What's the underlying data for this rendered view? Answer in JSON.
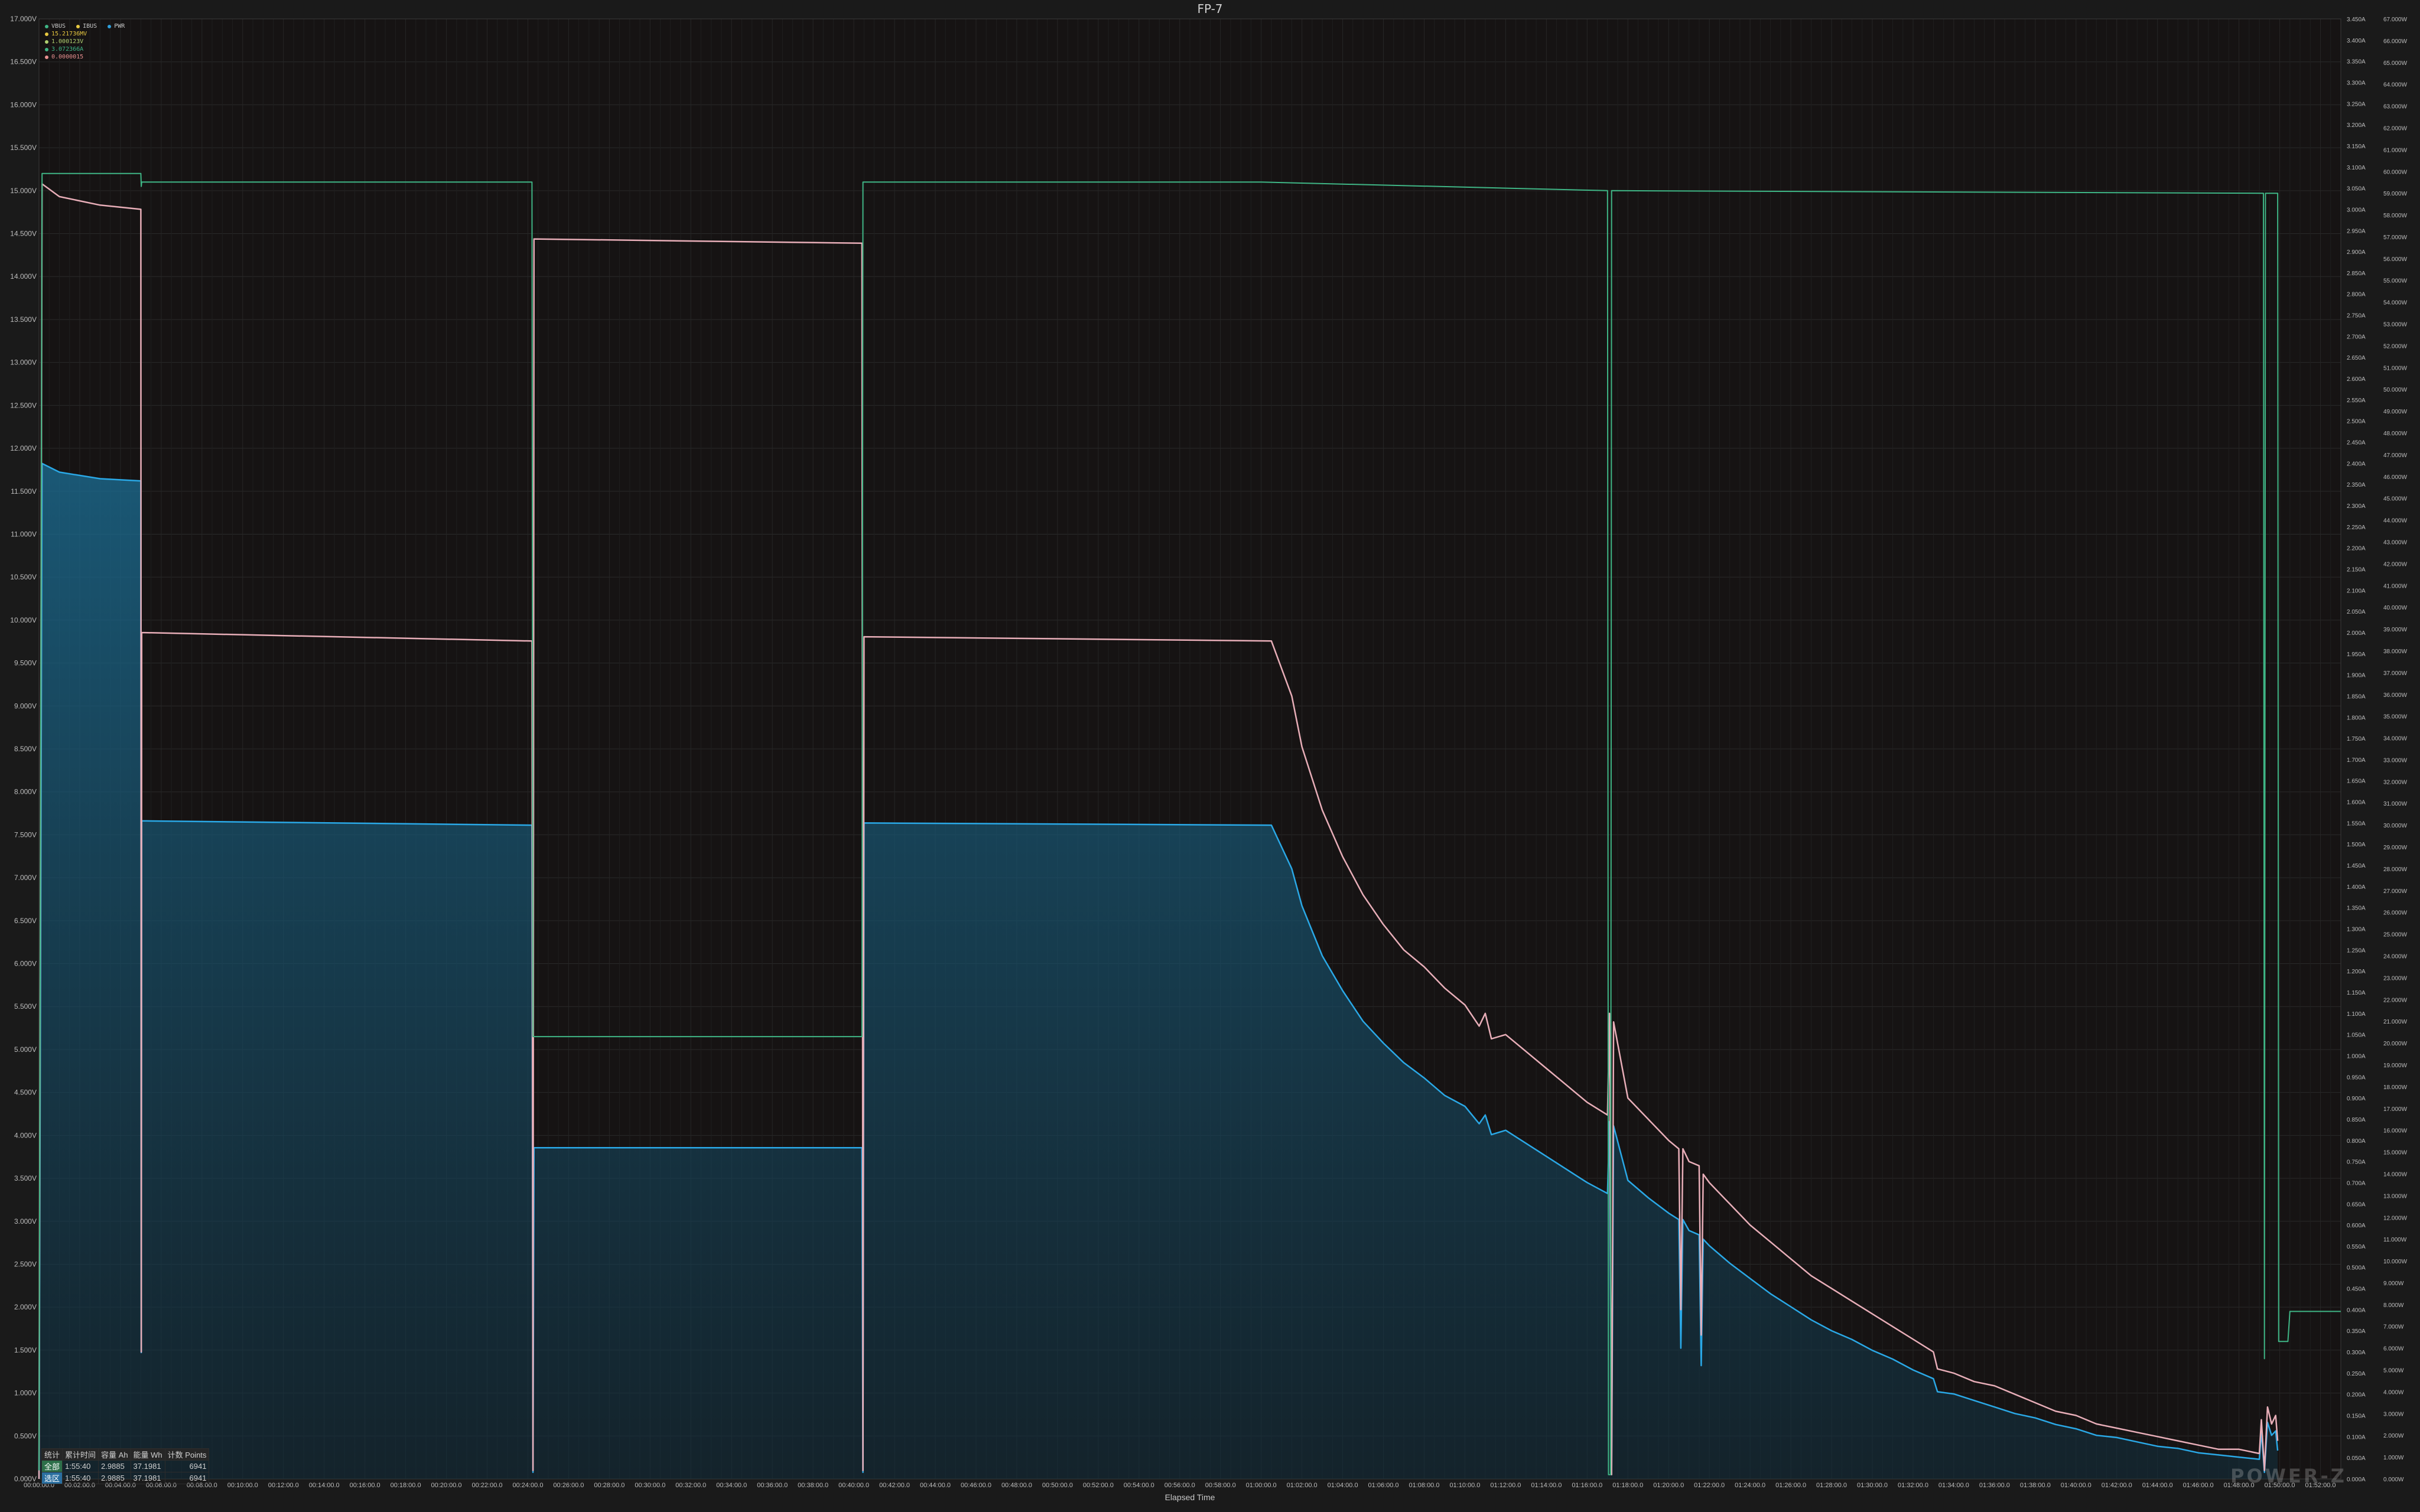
{
  "window": {
    "title": "FP-7"
  },
  "legend": [
    {
      "name": "VBUS",
      "color": "#3fb585"
    },
    {
      "name": "IBUS",
      "color": "#e8c840"
    },
    {
      "name": "PWR",
      "color": "#2f9fdc"
    }
  ],
  "readings": [
    {
      "value": "15.21736MV",
      "color": "#e8c840"
    },
    {
      "value": "1.000123V",
      "color": "#b0d070"
    },
    {
      "value": "3.072366A",
      "color": "#3fb585"
    },
    {
      "value": "0.0000015",
      "color": "#e89090"
    }
  ],
  "stats": {
    "headers": [
      "统计",
      "累计时间",
      "容量 Ah",
      "能量 Wh",
      "计数 Points"
    ],
    "rows": [
      {
        "tag": "全部",
        "time": "1:55:40",
        "ah": "2.9885",
        "wh": "37.1981",
        "points": "6941"
      },
      {
        "tag": "选区",
        "time": "1:55:40",
        "ah": "2.9885",
        "wh": "37.1981",
        "points": "6941"
      }
    ]
  },
  "watermark": "POWER-Z",
  "chart_data": {
    "type": "line",
    "title": "FP-7",
    "xlabel": "Elapsed Time",
    "xlim": [
      0,
      113
    ],
    "x_unit": "minutes",
    "x_ticks": [
      "00:00:00.0",
      "00:02:00.0",
      "00:04:00.0",
      "00:06:00.0",
      "00:08:00.0",
      "00:10:00.0",
      "00:12:00.0",
      "00:14:00.0",
      "00:16:00.0",
      "00:18:00.0",
      "00:20:00.0",
      "00:22:00.0",
      "00:24:00.0",
      "00:26:00.0",
      "00:28:00.0",
      "00:30:00.0",
      "00:32:00.0",
      "00:34:00.0",
      "00:36:00.0",
      "00:38:00.0",
      "00:40:00.0",
      "00:42:00.0",
      "00:44:00.0",
      "00:46:00.0",
      "00:48:00.0",
      "00:50:00.0",
      "00:52:00.0",
      "00:54:00.0",
      "00:56:00.0",
      "00:58:00.0",
      "01:00:00.0",
      "01:02:00.0",
      "01:04:00.0",
      "01:06:00.0",
      "01:08:00.0",
      "01:10:00.0",
      "01:12:00.0",
      "01:14:00.0",
      "01:16:00.0",
      "01:18:00.0",
      "01:20:00.0",
      "01:22:00.0",
      "01:24:00.0",
      "01:26:00.0",
      "01:28:00.0",
      "01:30:00.0",
      "01:32:00.0",
      "01:34:00.0",
      "01:36:00.0",
      "01:38:00.0",
      "01:40:00.0",
      "01:42:00.0",
      "01:44:00.0",
      "01:46:00.0",
      "01:48:00.0",
      "01:50:00.0",
      "01:52:00.0",
      "01:54:00.0"
    ],
    "y_left": {
      "min": 0,
      "max": 17,
      "step": 0.5,
      "unit": "V"
    },
    "y_right_current": {
      "min": 0,
      "max": 3.45,
      "step": 0.05,
      "unit": "A"
    },
    "y_right_power": {
      "min": 0,
      "max": 67,
      "step": 1,
      "unit": "W"
    },
    "grid": true,
    "legend_position": "top-left",
    "series": [
      {
        "name": "VBUS",
        "color": "#3fb585",
        "axis": "voltage",
        "points": [
          [
            0,
            0.1
          ],
          [
            0.15,
            15.2
          ],
          [
            5,
            15.2
          ],
          [
            5.02,
            15.05
          ],
          [
            5.04,
            15.1
          ],
          [
            24.2,
            15.1
          ],
          [
            24.25,
            5.15
          ],
          [
            40.4,
            5.15
          ],
          [
            40.45,
            15.1
          ],
          [
            60,
            15.1
          ],
          [
            77,
            15.0
          ],
          [
            77.05,
            0.05
          ],
          [
            77.15,
            0.05
          ],
          [
            77.2,
            15.0
          ],
          [
            109.2,
            14.97
          ],
          [
            109.25,
            1.4
          ],
          [
            109.3,
            14.97
          ],
          [
            109.9,
            14.97
          ],
          [
            109.95,
            1.6
          ],
          [
            110.4,
            1.6
          ],
          [
            110.5,
            1.95
          ],
          [
            113,
            1.95
          ]
        ]
      },
      {
        "name": "IBUS",
        "color": "#e8aeb8",
        "axis": "current",
        "points": [
          [
            0,
            0.0
          ],
          [
            0.15,
            3.06
          ],
          [
            1,
            3.03
          ],
          [
            3,
            3.01
          ],
          [
            5,
            3.0
          ],
          [
            5.02,
            0.3
          ],
          [
            5.04,
            2.0
          ],
          [
            24.2,
            1.98
          ],
          [
            24.25,
            0.02
          ],
          [
            24.3,
            2.93
          ],
          [
            40.4,
            2.92
          ],
          [
            40.45,
            0.02
          ],
          [
            40.5,
            1.99
          ],
          [
            60.5,
            1.98
          ],
          [
            61.5,
            1.85
          ],
          [
            62,
            1.73
          ],
          [
            63,
            1.58
          ],
          [
            64,
            1.47
          ],
          [
            65,
            1.38
          ],
          [
            66,
            1.31
          ],
          [
            67,
            1.25
          ],
          [
            68,
            1.21
          ],
          [
            69,
            1.16
          ],
          [
            70,
            1.12
          ],
          [
            70.7,
            1.07
          ],
          [
            71,
            1.1
          ],
          [
            71.3,
            1.04
          ],
          [
            72,
            1.05
          ],
          [
            73,
            1.01
          ],
          [
            74,
            0.97
          ],
          [
            75,
            0.93
          ],
          [
            76,
            0.89
          ],
          [
            77,
            0.86
          ],
          [
            77.1,
            1.1
          ],
          [
            77.2,
            0.01
          ],
          [
            77.3,
            1.08
          ],
          [
            78,
            0.9
          ],
          [
            79,
            0.85
          ],
          [
            80,
            0.8
          ],
          [
            80.5,
            0.78
          ],
          [
            80.6,
            0.4
          ],
          [
            80.7,
            0.78
          ],
          [
            81,
            0.75
          ],
          [
            81.5,
            0.74
          ],
          [
            81.6,
            0.34
          ],
          [
            81.7,
            0.72
          ],
          [
            82,
            0.7
          ],
          [
            83,
            0.65
          ],
          [
            84,
            0.6
          ],
          [
            85,
            0.56
          ],
          [
            86,
            0.52
          ],
          [
            87,
            0.48
          ],
          [
            88,
            0.45
          ],
          [
            89,
            0.42
          ],
          [
            90,
            0.39
          ],
          [
            91,
            0.36
          ],
          [
            92,
            0.33
          ],
          [
            93,
            0.3
          ],
          [
            93.2,
            0.26
          ],
          [
            94,
            0.25
          ],
          [
            95,
            0.23
          ],
          [
            96,
            0.22
          ],
          [
            97,
            0.2
          ],
          [
            98,
            0.18
          ],
          [
            99,
            0.16
          ],
          [
            100,
            0.15
          ],
          [
            101,
            0.13
          ],
          [
            102,
            0.12
          ],
          [
            103,
            0.11
          ],
          [
            104,
            0.1
          ],
          [
            105,
            0.09
          ],
          [
            106,
            0.08
          ],
          [
            107,
            0.07
          ],
          [
            108,
            0.07
          ],
          [
            109,
            0.06
          ],
          [
            109.1,
            0.14
          ],
          [
            109.25,
            0.02
          ],
          [
            109.4,
            0.17
          ],
          [
            109.6,
            0.13
          ],
          [
            109.8,
            0.15
          ],
          [
            109.9,
            0.09
          ]
        ]
      },
      {
        "name": "PWR",
        "color": "#2aa8e6",
        "axis": "power",
        "points": [
          [
            0,
            0.0
          ],
          [
            0.15,
            46.6
          ],
          [
            1,
            46.2
          ],
          [
            3,
            45.9
          ],
          [
            5,
            45.8
          ],
          [
            5.02,
            5.8
          ],
          [
            5.04,
            30.2
          ],
          [
            24.2,
            30.0
          ],
          [
            24.25,
            0.3
          ],
          [
            24.3,
            15.2
          ],
          [
            40.4,
            15.2
          ],
          [
            40.45,
            0.3
          ],
          [
            40.5,
            30.1
          ],
          [
            60.5,
            30.0
          ],
          [
            61.5,
            28.0
          ],
          [
            62,
            26.3
          ],
          [
            63,
            24.0
          ],
          [
            64,
            22.4
          ],
          [
            65,
            21.0
          ],
          [
            66,
            20.0
          ],
          [
            67,
            19.1
          ],
          [
            68,
            18.4
          ],
          [
            69,
            17.6
          ],
          [
            70,
            17.1
          ],
          [
            70.7,
            16.3
          ],
          [
            71,
            16.7
          ],
          [
            71.3,
            15.8
          ],
          [
            72,
            16.0
          ],
          [
            73,
            15.4
          ],
          [
            74,
            14.8
          ],
          [
            75,
            14.2
          ],
          [
            76,
            13.6
          ],
          [
            77,
            13.1
          ],
          [
            77.1,
            16.4
          ],
          [
            77.2,
            0.2
          ],
          [
            77.3,
            16.2
          ],
          [
            78,
            13.7
          ],
          [
            79,
            12.9
          ],
          [
            80,
            12.2
          ],
          [
            80.5,
            11.9
          ],
          [
            80.6,
            6.0
          ],
          [
            80.7,
            11.9
          ],
          [
            81,
            11.4
          ],
          [
            81.5,
            11.2
          ],
          [
            81.6,
            5.2
          ],
          [
            81.7,
            11.0
          ],
          [
            82,
            10.7
          ],
          [
            83,
            9.9
          ],
          [
            84,
            9.2
          ],
          [
            85,
            8.5
          ],
          [
            86,
            7.9
          ],
          [
            87,
            7.3
          ],
          [
            88,
            6.8
          ],
          [
            89,
            6.4
          ],
          [
            90,
            5.9
          ],
          [
            91,
            5.5
          ],
          [
            92,
            5.0
          ],
          [
            93,
            4.6
          ],
          [
            93.2,
            4.0
          ],
          [
            94,
            3.9
          ],
          [
            95,
            3.6
          ],
          [
            96,
            3.3
          ],
          [
            97,
            3.0
          ],
          [
            98,
            2.8
          ],
          [
            99,
            2.5
          ],
          [
            100,
            2.3
          ],
          [
            101,
            2.0
          ],
          [
            102,
            1.9
          ],
          [
            103,
            1.7
          ],
          [
            104,
            1.5
          ],
          [
            105,
            1.4
          ],
          [
            106,
            1.2
          ],
          [
            107,
            1.1
          ],
          [
            108,
            1.0
          ],
          [
            109,
            0.9
          ],
          [
            109.1,
            2.2
          ],
          [
            109.25,
            0.3
          ],
          [
            109.4,
            2.6
          ],
          [
            109.6,
            2.0
          ],
          [
            109.8,
            2.2
          ],
          [
            109.9,
            1.3
          ]
        ]
      }
    ]
  }
}
